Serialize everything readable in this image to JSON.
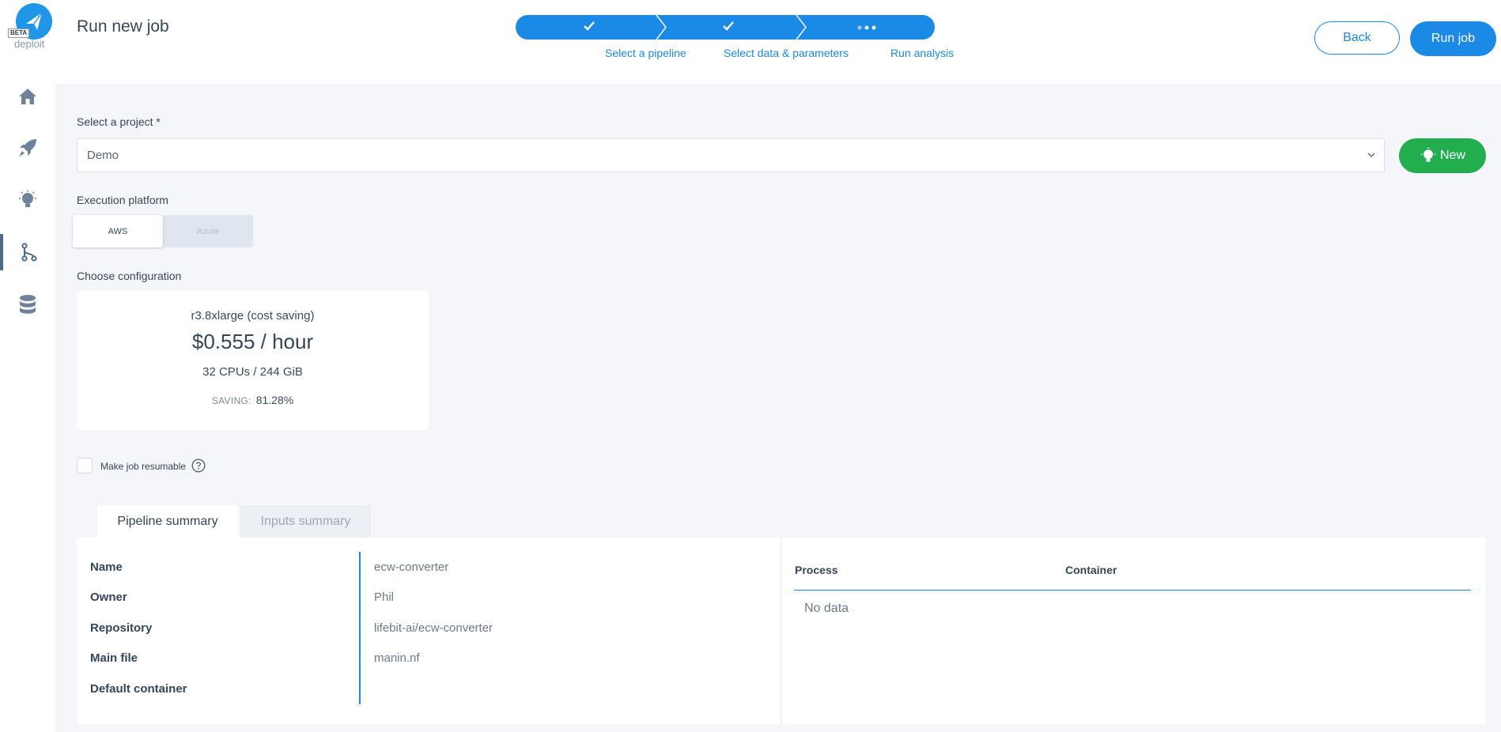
{
  "brand": {
    "badge": "BETA",
    "name": "deploit"
  },
  "sidebar": {
    "items": [
      {
        "icon": "home-icon"
      },
      {
        "icon": "rocket-icon"
      },
      {
        "icon": "lightbulb-icon"
      },
      {
        "icon": "pipeline-icon",
        "active": true
      },
      {
        "icon": "database-icon"
      }
    ]
  },
  "header": {
    "title": "Run new job",
    "steps": [
      {
        "label": "Select a pipeline",
        "status": "done"
      },
      {
        "label": "Select data & parameters",
        "status": "done"
      },
      {
        "label": "Run analysis",
        "status": "in-progress"
      }
    ],
    "back_label": "Back",
    "run_label": "Run job"
  },
  "project": {
    "label": "Select a project *",
    "value": "Demo",
    "new_label": "New"
  },
  "platform": {
    "label": "Execution platform",
    "options": [
      "AWS",
      "Azure"
    ],
    "selected": "AWS"
  },
  "configuration": {
    "label": "Choose configuration",
    "instance": "r3.8xlarge (cost saving)",
    "price": "$0.555 / hour",
    "resources": "32 CPUs / 244 GiB",
    "saving_key": "SAVING:",
    "saving_value": "81.28%"
  },
  "resumable": {
    "label": "Make job resumable",
    "checked": false
  },
  "tabs": {
    "pipeline": "Pipeline summary",
    "inputs": "Inputs summary"
  },
  "summary": {
    "rows": [
      {
        "key": "Name",
        "value": "ecw-converter"
      },
      {
        "key": "Owner",
        "value": "Phil"
      },
      {
        "key": "Repository",
        "value": "lifebit-ai/ecw-converter"
      },
      {
        "key": "Main file",
        "value": "manin.nf"
      },
      {
        "key": "Default container",
        "value": ""
      }
    ],
    "table_headers": [
      "Process",
      "Container"
    ],
    "empty_text": "No data"
  },
  "colors": {
    "primary": "#1b8ae6",
    "success": "#22ad4e",
    "text": "#34465a"
  }
}
